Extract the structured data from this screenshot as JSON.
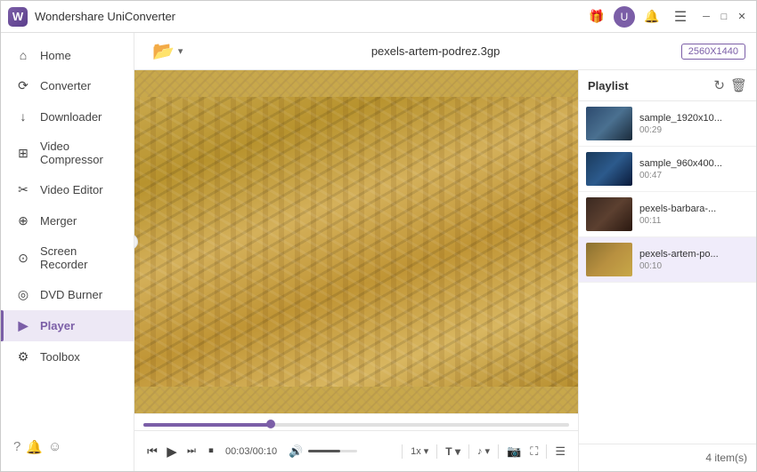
{
  "app": {
    "title": "Wondershare UniConverter",
    "logo": "W"
  },
  "titlebar": {
    "gift_icon": "🎁",
    "user_icon": "👤",
    "bell_icon": "🔔",
    "menu_icon": "☰",
    "min_icon": "─",
    "max_icon": "□",
    "close_icon": "✕"
  },
  "sidebar": {
    "items": [
      {
        "id": "home",
        "label": "Home",
        "icon": "⌂"
      },
      {
        "id": "converter",
        "label": "Converter",
        "icon": "⟳"
      },
      {
        "id": "downloader",
        "label": "Downloader",
        "icon": "↓"
      },
      {
        "id": "video-compressor",
        "label": "Video Compressor",
        "icon": "⊞"
      },
      {
        "id": "video-editor",
        "label": "Video Editor",
        "icon": "✂"
      },
      {
        "id": "merger",
        "label": "Merger",
        "icon": "⊕"
      },
      {
        "id": "screen-recorder",
        "label": "Screen Recorder",
        "icon": "⊙"
      },
      {
        "id": "dvd-burner",
        "label": "DVD Burner",
        "icon": "◎"
      },
      {
        "id": "player",
        "label": "Player",
        "icon": "▶",
        "active": true
      },
      {
        "id": "toolbox",
        "label": "Toolbox",
        "icon": "⚙"
      }
    ],
    "footer_icons": [
      "?",
      "🔔",
      "☺"
    ]
  },
  "topbar": {
    "filename": "pexels-artem-podrez.3gp",
    "resolution": "2560X1440",
    "add_icon": "📂",
    "dropdown_icon": "▾"
  },
  "playlist": {
    "title": "Playlist",
    "refresh_icon": "↻",
    "delete_icon": "🗑",
    "items": [
      {
        "id": 1,
        "name": "sample_1920x10...",
        "duration": "00:29",
        "thumb_class": "thumb-1"
      },
      {
        "id": 2,
        "name": "sample_960x400...",
        "duration": "00:47",
        "thumb_class": "thumb-2"
      },
      {
        "id": 3,
        "name": "pexels-barbara-...",
        "duration": "00:11",
        "thumb_class": "thumb-3"
      },
      {
        "id": 4,
        "name": "pexels-artem-po...",
        "duration": "00:10",
        "thumb_class": "thumb-4",
        "active": true
      }
    ],
    "item_count": "4 item(s)"
  },
  "controls": {
    "prev_icon": "⏮",
    "play_icon": "▶",
    "next_icon": "⏭",
    "stop_icon": "⏹",
    "time_current": "00:03",
    "time_total": "00:10",
    "volume_icon": "🔊",
    "speed_icon": "⚡",
    "subtitle_icon": "T",
    "audio_icon": "🎵",
    "screenshot_icon": "📷",
    "fullscreen_icon": "⛶",
    "playlist_icon": "☰",
    "progress_pct": 30
  }
}
